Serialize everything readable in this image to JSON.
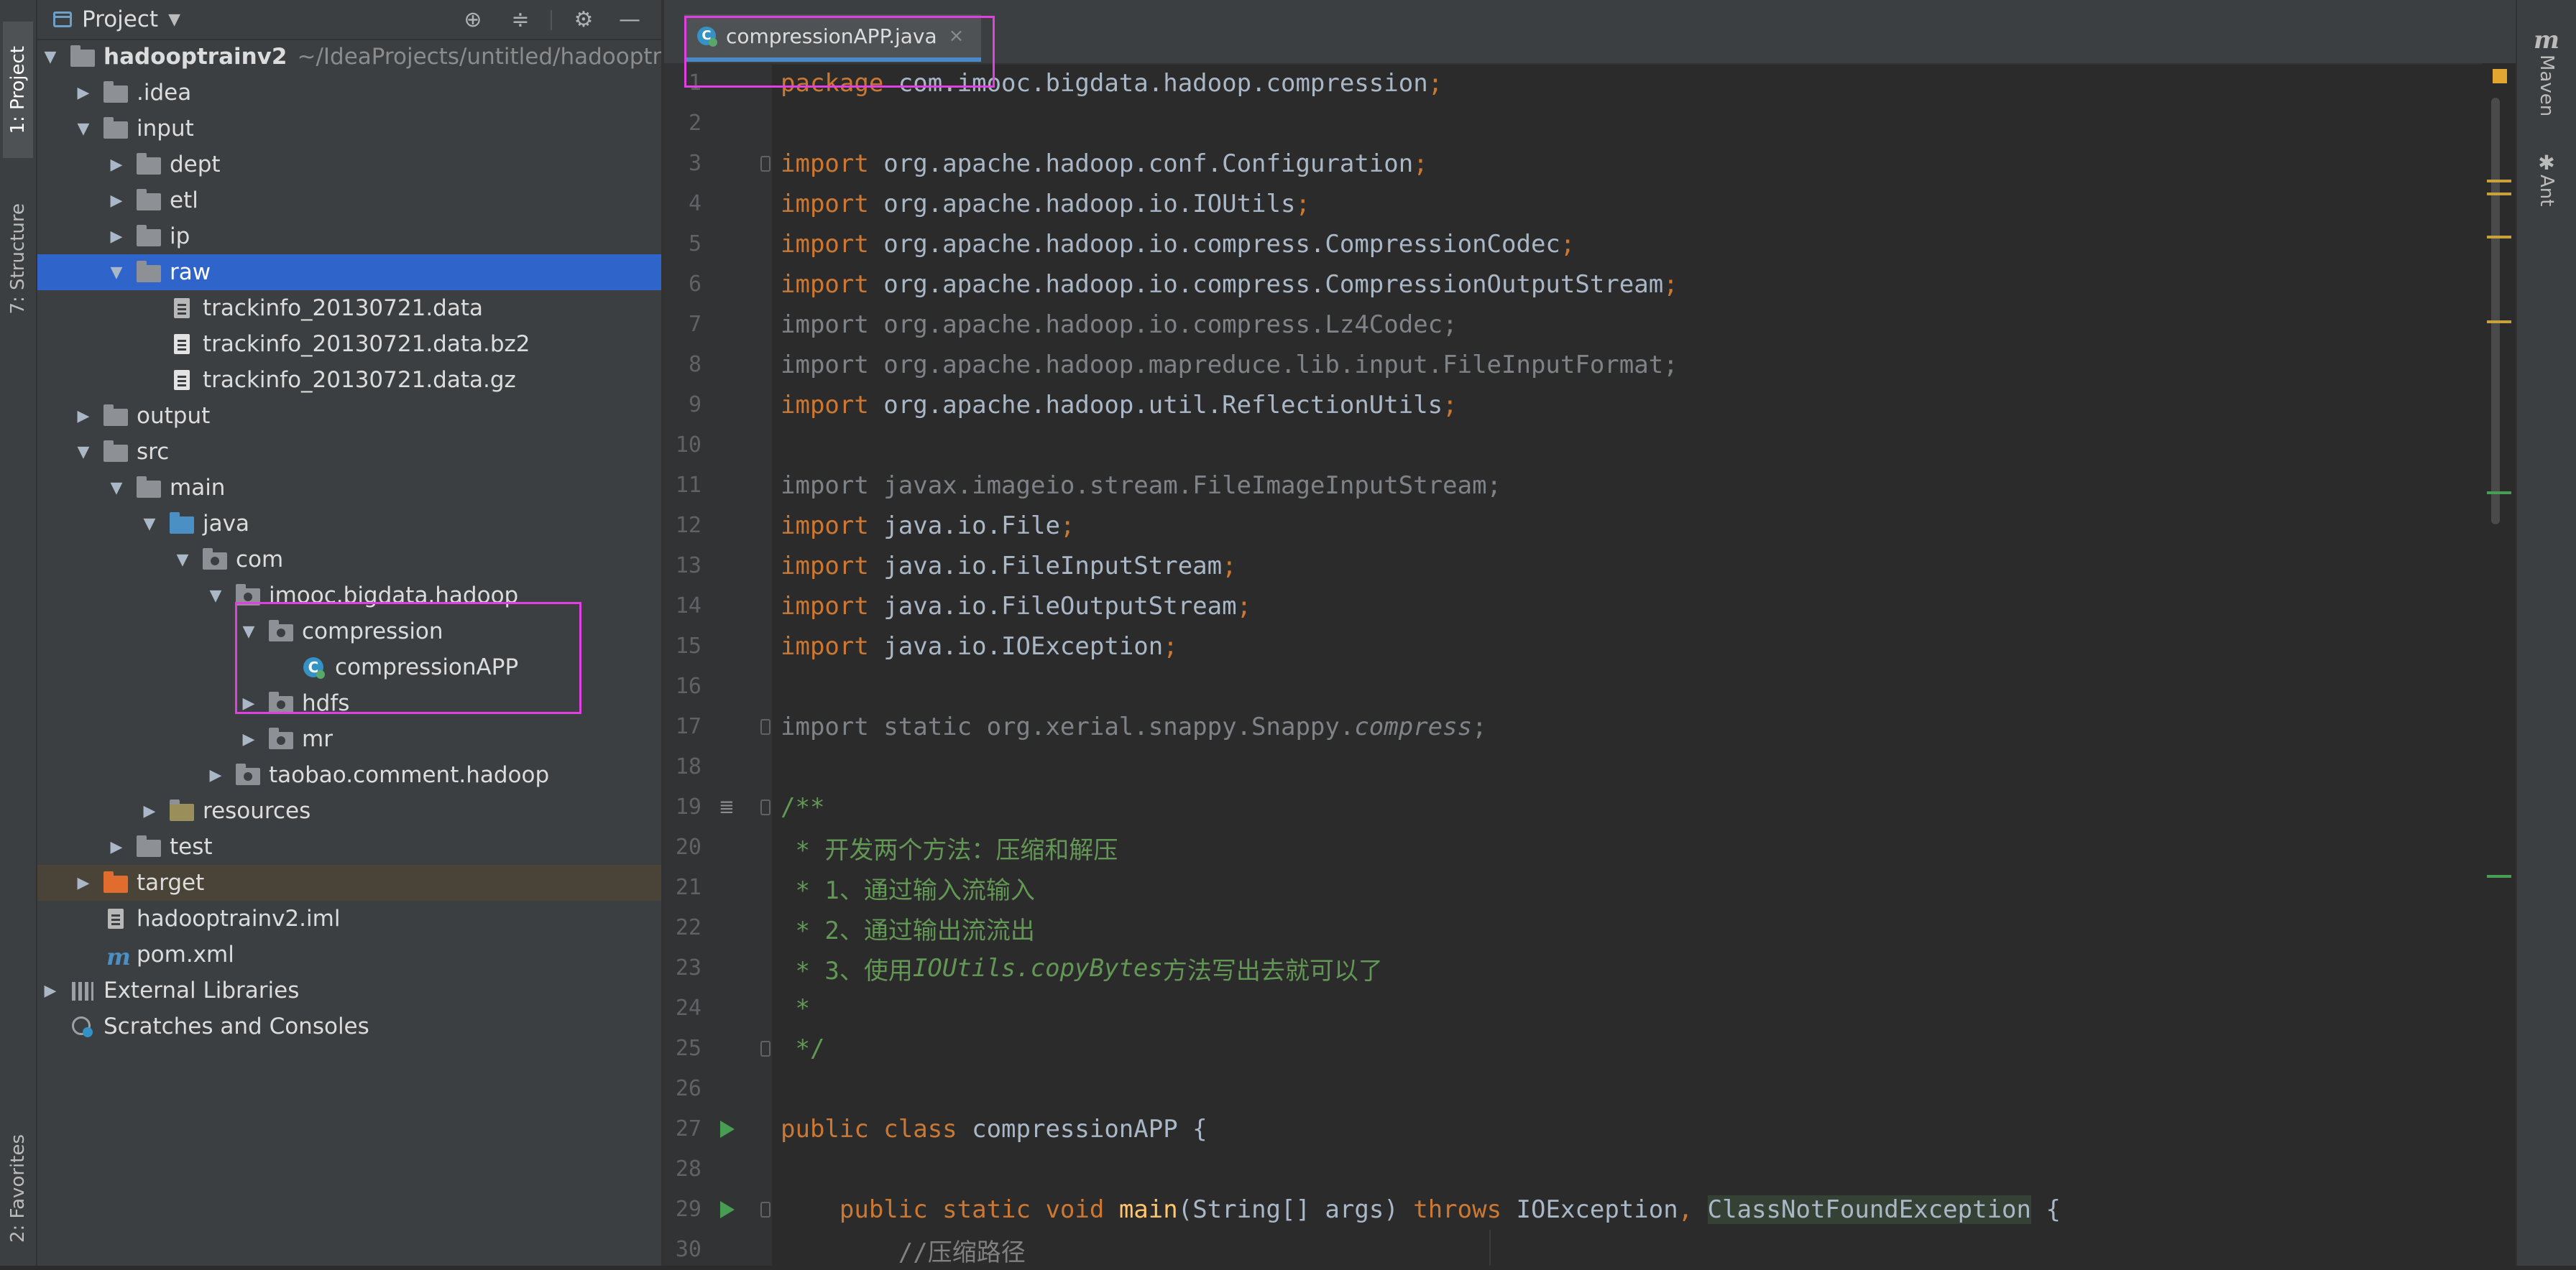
{
  "left_strip": {
    "tabs": [
      {
        "label": "1: Project",
        "active": true
      },
      {
        "label": "7: Structure",
        "active": false
      },
      {
        "label": "2: Favorites",
        "active": false
      }
    ]
  },
  "project_panel": {
    "title": "Project",
    "header_icons": [
      "locate-icon",
      "collapse-all-icon",
      "settings-icon",
      "hide-icon"
    ],
    "tree": [
      {
        "label": "hadooptrainv2",
        "path": "~/IdeaProjects/untitled/hadooptr",
        "arrow": "down",
        "icon": "module-folder"
      },
      {
        "label": ".idea",
        "arrow": "right",
        "icon": "folder"
      },
      {
        "label": "input",
        "arrow": "down",
        "icon": "folder"
      },
      {
        "label": "dept",
        "arrow": "right",
        "icon": "folder"
      },
      {
        "label": "etl",
        "arrow": "right",
        "icon": "folder"
      },
      {
        "label": "ip",
        "arrow": "right",
        "icon": "folder"
      },
      {
        "label": "raw",
        "arrow": "down",
        "icon": "folder",
        "selected": true
      },
      {
        "label": "trackinfo_20130721.data",
        "arrow": "none",
        "icon": "text-file"
      },
      {
        "label": "trackinfo_20130721.data.bz2",
        "arrow": "none",
        "icon": "file"
      },
      {
        "label": "trackinfo_20130721.data.gz",
        "arrow": "none",
        "icon": "file"
      },
      {
        "label": "output",
        "arrow": "right",
        "icon": "folder"
      },
      {
        "label": "src",
        "arrow": "down",
        "icon": "folder"
      },
      {
        "label": "main",
        "arrow": "down",
        "icon": "folder"
      },
      {
        "label": "java",
        "arrow": "down",
        "icon": "source-folder"
      },
      {
        "label": "com",
        "arrow": "down",
        "icon": "package"
      },
      {
        "label": "imooc.bigdata.hadoop",
        "arrow": "down",
        "icon": "package"
      },
      {
        "label": "compression",
        "arrow": "down",
        "icon": "package"
      },
      {
        "label": "compressionAPP",
        "arrow": "none",
        "icon": "class"
      },
      {
        "label": "hdfs",
        "arrow": "right",
        "icon": "package"
      },
      {
        "label": "mr",
        "arrow": "right",
        "icon": "package"
      },
      {
        "label": "taobao.comment.hadoop",
        "arrow": "right",
        "icon": "package"
      },
      {
        "label": "resources",
        "arrow": "right",
        "icon": "resources-folder"
      },
      {
        "label": "test",
        "arrow": "right",
        "icon": "folder"
      },
      {
        "label": "target",
        "arrow": "right",
        "icon": "excluded-folder",
        "excluded": true
      },
      {
        "label": "hadooptrainv2.iml",
        "arrow": "none",
        "icon": "iml-file"
      },
      {
        "label": "pom.xml",
        "arrow": "none",
        "icon": "maven-file"
      },
      {
        "label": "External Libraries",
        "arrow": "right",
        "icon": "libraries"
      },
      {
        "label": "Scratches and Consoles",
        "arrow": "none",
        "icon": "scratches"
      }
    ]
  },
  "editor": {
    "active_tab": {
      "label": "compressionAPP.java",
      "close": "×"
    },
    "lines": [
      {
        "n": "1",
        "tokens": [
          [
            "kw",
            "package "
          ],
          [
            "pkg",
            "com.imooc.bigdata.hadoop.compression"
          ],
          [
            "kw",
            ";"
          ]
        ]
      },
      {
        "n": "2",
        "tokens": []
      },
      {
        "n": "3",
        "fold": true,
        "tokens": [
          [
            "kw",
            "import "
          ],
          [
            "pkg",
            "org.apache.hadoop.conf.Configuration"
          ],
          [
            "kw",
            ";"
          ]
        ]
      },
      {
        "n": "4",
        "tokens": [
          [
            "kw",
            "import "
          ],
          [
            "pkg",
            "org.apache.hadoop.io.IOUtils"
          ],
          [
            "kw",
            ";"
          ]
        ]
      },
      {
        "n": "5",
        "tokens": [
          [
            "kw",
            "import "
          ],
          [
            "pkg",
            "org.apache.hadoop.io.compress.CompressionCodec"
          ],
          [
            "kw",
            ";"
          ]
        ]
      },
      {
        "n": "6",
        "tokens": [
          [
            "kw",
            "import "
          ],
          [
            "pkg",
            "org.apache.hadoop.io.compress.CompressionOutputStream"
          ],
          [
            "kw",
            ";"
          ]
        ]
      },
      {
        "n": "7",
        "tokens": [
          [
            "dim",
            "import org.apache.hadoop.io.compress.Lz4Codec;"
          ]
        ]
      },
      {
        "n": "8",
        "tokens": [
          [
            "dim",
            "import org.apache.hadoop.mapreduce.lib.input.FileInputFormat;"
          ]
        ]
      },
      {
        "n": "9",
        "tokens": [
          [
            "kw",
            "import "
          ],
          [
            "pkg",
            "org.apache.hadoop.util.ReflectionUtils"
          ],
          [
            "kw",
            ";"
          ]
        ]
      },
      {
        "n": "10",
        "tokens": []
      },
      {
        "n": "11",
        "tokens": [
          [
            "dim",
            "import javax.imageio.stream.FileImageInputStream;"
          ]
        ]
      },
      {
        "n": "12",
        "tokens": [
          [
            "kw",
            "import "
          ],
          [
            "pkg",
            "java.io.File"
          ],
          [
            "kw",
            ";"
          ]
        ]
      },
      {
        "n": "13",
        "tokens": [
          [
            "kw",
            "import "
          ],
          [
            "pkg",
            "java.io.FileInputStream"
          ],
          [
            "kw",
            ";"
          ]
        ]
      },
      {
        "n": "14",
        "tokens": [
          [
            "kw",
            "import "
          ],
          [
            "pkg",
            "java.io.FileOutputStream"
          ],
          [
            "kw",
            ";"
          ]
        ]
      },
      {
        "n": "15",
        "tokens": [
          [
            "kw",
            "import "
          ],
          [
            "pkg",
            "java.io.IOException"
          ],
          [
            "kw",
            ";"
          ]
        ]
      },
      {
        "n": "16",
        "tokens": []
      },
      {
        "n": "17",
        "fold": true,
        "tokens": [
          [
            "dim",
            "import static org.xerial.snappy.Snappy."
          ],
          [
            "static",
            "compress"
          ],
          [
            "dim",
            ";"
          ]
        ]
      },
      {
        "n": "18",
        "tokens": []
      },
      {
        "n": "19",
        "fold": true,
        "doc": true,
        "tokens": [
          [
            "doc",
            "/**"
          ]
        ]
      },
      {
        "n": "20",
        "tokens": [
          [
            "doc",
            " * 开发两个方法：压缩和解压"
          ]
        ]
      },
      {
        "n": "21",
        "tokens": [
          [
            "doc",
            " * 1、通过输入流输入"
          ]
        ]
      },
      {
        "n": "22",
        "tokens": [
          [
            "doc",
            " * 2、通过输出流流出"
          ]
        ]
      },
      {
        "n": "23",
        "tokens": [
          [
            "doc",
            " * 3、使用"
          ],
          [
            "doctag",
            "IOUtils.copyBytes"
          ],
          [
            "doc",
            "方法写出去就可以了"
          ]
        ]
      },
      {
        "n": "24",
        "tokens": [
          [
            "doc",
            " *"
          ]
        ]
      },
      {
        "n": "25",
        "fold": true,
        "tokens": [
          [
            "doc",
            " */"
          ]
        ]
      },
      {
        "n": "26",
        "tokens": []
      },
      {
        "n": "27",
        "run": true,
        "tokens": [
          [
            "kw",
            "public class "
          ],
          [
            "pkg",
            "compressionAPP {"
          ]
        ]
      },
      {
        "n": "28",
        "tokens": []
      },
      {
        "n": "29",
        "run": true,
        "fold": true,
        "tokens": [
          [
            "pkg",
            "    "
          ],
          [
            "kw",
            "public static void "
          ],
          [
            "method",
            "main"
          ],
          [
            "pkg",
            "(String[] args) "
          ],
          [
            "kw",
            "throws "
          ],
          [
            "pkg",
            "IOException"
          ],
          [
            "kw",
            ", "
          ],
          [
            "hl",
            "ClassNotFoundException"
          ],
          [
            "pkg",
            " {"
          ]
        ]
      },
      {
        "n": "30",
        "tokens": [
          [
            "pkg",
            "        "
          ],
          [
            "comment",
            "//压缩路径"
          ]
        ]
      }
    ]
  },
  "right_strip": {
    "tabs": [
      {
        "label": "Maven",
        "icon": "maven-icon"
      },
      {
        "label": "Ant",
        "icon": "ant-icon"
      }
    ]
  },
  "colors": {
    "keyword": "#cc7832",
    "identifier": "#a9b7c6",
    "doc_comment": "#629755",
    "selection": "#2f65ca",
    "annotation_box": "#e040e0"
  }
}
